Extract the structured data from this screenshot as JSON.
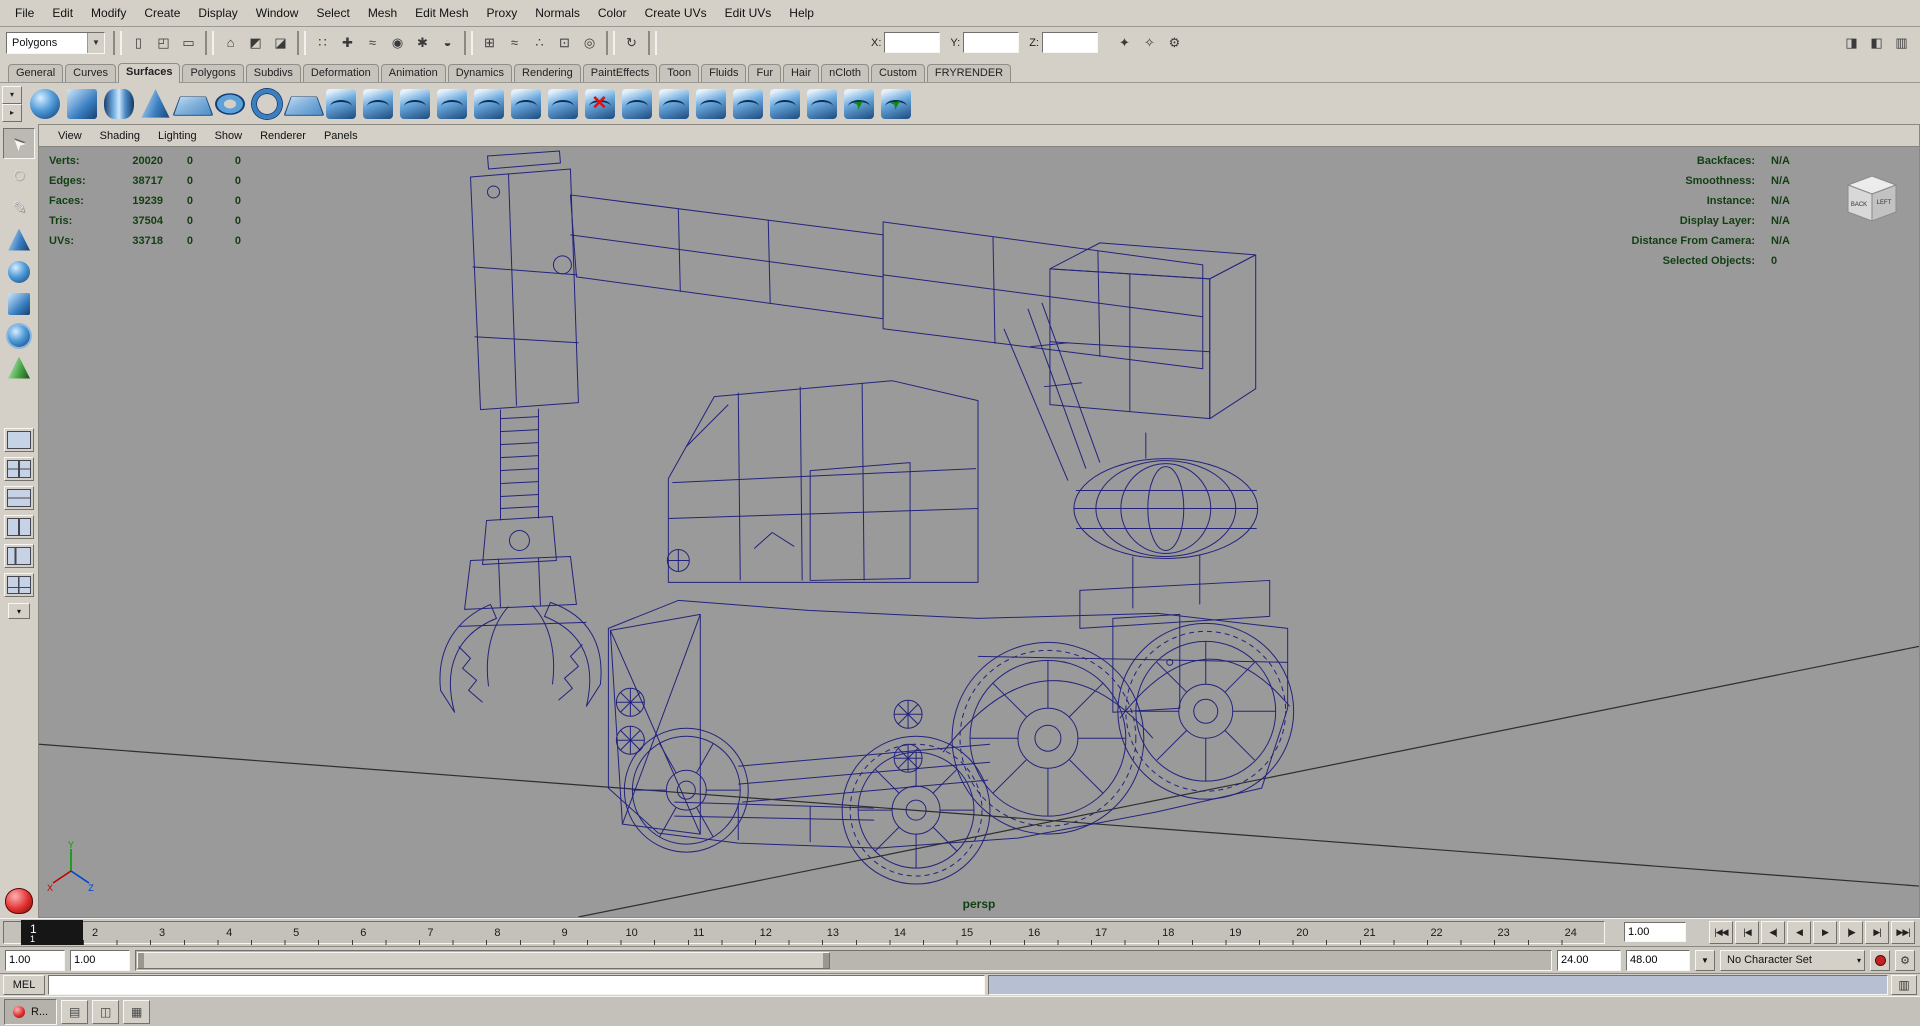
{
  "menubar": {
    "items": [
      "File",
      "Edit",
      "Modify",
      "Create",
      "Display",
      "Window",
      "Select",
      "Mesh",
      "Edit Mesh",
      "Proxy",
      "Normals",
      "Color",
      "Create UVs",
      "Edit UVs",
      "Help"
    ]
  },
  "status_line": {
    "selection_mode": "Polygons",
    "icons": [
      {
        "sep": true
      },
      {
        "name": "new-scene-icon",
        "glyph": "▯"
      },
      {
        "name": "open-scene-icon",
        "glyph": "◰"
      },
      {
        "name": "save-scene-icon",
        "glyph": "▭"
      },
      {
        "sep": true
      },
      {
        "name": "select-by-hierarchy-icon",
        "glyph": "⌂"
      },
      {
        "name": "select-by-object-icon",
        "glyph": "◩"
      },
      {
        "name": "select-by-component-icon",
        "glyph": "◪"
      },
      {
        "sep": true
      },
      {
        "name": "mask-points-icon",
        "glyph": "∷"
      },
      {
        "name": "mask-handles-icon",
        "glyph": "✚"
      },
      {
        "name": "mask-lines-icon",
        "glyph": "≈"
      },
      {
        "name": "mask-surfaces-icon",
        "glyph": "◉"
      },
      {
        "name": "mask-dynamics-icon",
        "glyph": "✱"
      },
      {
        "name": "mask-rendering-icon",
        "glyph": "◒"
      },
      {
        "sep": true
      },
      {
        "name": "snap-to-grid-icon",
        "glyph": "⊞"
      },
      {
        "name": "snap-to-curve-icon",
        "glyph": "≈"
      },
      {
        "name": "snap-to-point-icon",
        "glyph": "∴"
      },
      {
        "name": "snap-to-plane-icon",
        "glyph": "⊡"
      },
      {
        "name": "make-live-icon",
        "glyph": "◎"
      },
      {
        "sep": true
      },
      {
        "name": "construction-history-icon",
        "glyph": "↻"
      },
      {
        "sep": true
      }
    ],
    "coord_fields": {
      "x_label": "X:",
      "x_value": "",
      "y_label": "Y:",
      "y_value": "",
      "z_label": "Z:",
      "z_value": ""
    },
    "render_icons": [
      {
        "name": "render-current-frame-icon",
        "glyph": "✦"
      },
      {
        "name": "ipr-render-icon",
        "glyph": "✧"
      },
      {
        "name": "render-settings-icon",
        "glyph": "⚙"
      }
    ],
    "right_icons": [
      {
        "name": "attribute-editor-toggle-icon",
        "glyph": "◨"
      },
      {
        "name": "tool-settings-toggle-icon",
        "glyph": "◧"
      },
      {
        "name": "channel-box-toggle-icon",
        "glyph": "▥"
      }
    ]
  },
  "shelf": {
    "tabs": [
      "General",
      "Curves",
      "Surfaces",
      "Polygons",
      "Subdivs",
      "Deformation",
      "Animation",
      "Dynamics",
      "Rendering",
      "PaintEffects",
      "Toon",
      "Fluids",
      "Fur",
      "Hair",
      "nCloth",
      "Custom",
      "FRYRENDER"
    ],
    "active_tab": "Surfaces",
    "items": [
      {
        "name": "nurbs-sphere",
        "shape": "sphere"
      },
      {
        "name": "nurbs-cube",
        "shape": "cube"
      },
      {
        "name": "nurbs-cylinder",
        "shape": "cylinder"
      },
      {
        "name": "nurbs-cone",
        "shape": "cone"
      },
      {
        "name": "nurbs-plane",
        "shape": "plane"
      },
      {
        "name": "nurbs-torus",
        "shape": "torus"
      },
      {
        "name": "nurbs-circle",
        "shape": "ring"
      },
      {
        "name": "nurbs-square",
        "shape": "plane"
      },
      {
        "name": "revolve",
        "shape": "surf"
      },
      {
        "name": "loft",
        "shape": "surf"
      },
      {
        "name": "planar",
        "shape": "surf"
      },
      {
        "name": "extrude",
        "shape": "surf"
      },
      {
        "name": "birail",
        "shape": "surf"
      },
      {
        "name": "boundary",
        "shape": "surf"
      },
      {
        "name": "bevel",
        "shape": "surf"
      },
      {
        "name": "boolean-difference",
        "shape": "surf-red"
      },
      {
        "name": "trim-tool",
        "shape": "surf"
      },
      {
        "name": "untrim",
        "shape": "surf"
      },
      {
        "name": "attach-surfaces",
        "shape": "surf"
      },
      {
        "name": "detach-surfaces",
        "shape": "surf"
      },
      {
        "name": "align-surfaces",
        "shape": "surf"
      },
      {
        "name": "open-close-surface",
        "shape": "surf"
      },
      {
        "name": "insert-isoparms",
        "shape": "surf-green"
      },
      {
        "name": "project-curve",
        "shape": "surf-green"
      }
    ]
  },
  "toolbox": {
    "tools": [
      {
        "name": "select-tool",
        "shape": "arrow",
        "active": true
      },
      {
        "name": "lasso-tool",
        "shape": "lasso"
      },
      {
        "name": "paint-select-tool",
        "shape": "brush"
      },
      {
        "name": "move-tool",
        "shape": "cone"
      },
      {
        "name": "rotate-tool",
        "shape": "sphere"
      },
      {
        "name": "scale-tool",
        "shape": "cube"
      },
      {
        "name": "universal-manipulator-tool",
        "shape": "sphere-ring"
      },
      {
        "name": "soft-modification-tool",
        "shape": "cone-green"
      }
    ],
    "layouts": [
      {
        "name": "layout-single-pane",
        "style": "l1"
      },
      {
        "name": "layout-four-panes",
        "style": "l4"
      },
      {
        "name": "layout-two-panes-stacked",
        "style": "l3"
      },
      {
        "name": "layout-two-panes-side",
        "style": "l2"
      },
      {
        "name": "layout-persp-outliner",
        "style": "l5"
      },
      {
        "name": "layout-persp-graph",
        "style": "l6"
      }
    ],
    "layout_menu_glyph": "▾",
    "shelf_mini_glyphs": [
      "▾",
      "▸"
    ]
  },
  "panel_menu": {
    "items": [
      "View",
      "Shading",
      "Lighting",
      "Show",
      "Renderer",
      "Panels"
    ]
  },
  "hud": {
    "left": [
      {
        "label": "Verts:",
        "v1": "20020",
        "v2": "0",
        "v3": "0"
      },
      {
        "label": "Edges:",
        "v1": "38717",
        "v2": "0",
        "v3": "0"
      },
      {
        "label": "Faces:",
        "v1": "19239",
        "v2": "0",
        "v3": "0"
      },
      {
        "label": "Tris:",
        "v1": "37504",
        "v2": "0",
        "v3": "0"
      },
      {
        "label": "UVs:",
        "v1": "33718",
        "v2": "0",
        "v3": "0"
      }
    ],
    "right": [
      {
        "label": "Backfaces:",
        "value": "N/A"
      },
      {
        "label": "Smoothness:",
        "value": "N/A"
      },
      {
        "label": "Instance:",
        "value": "N/A"
      },
      {
        "label": "Display Layer:",
        "value": "N/A"
      },
      {
        "label": "Distance From Camera:",
        "value": "N/A"
      },
      {
        "label": "Selected Objects:",
        "value": "0"
      }
    ]
  },
  "viewport": {
    "camera_label": "persp",
    "axis": {
      "x": "X",
      "y": "Y",
      "z": "Z"
    },
    "viewcube": {
      "face1": "BACK",
      "face2": "LEFT"
    }
  },
  "timeline": {
    "current_frame": "1",
    "frame_numbers": [
      "2",
      "3",
      "4",
      "5",
      "6",
      "7",
      "8",
      "9",
      "10",
      "11",
      "12",
      "13",
      "14",
      "15",
      "16",
      "17",
      "18",
      "19",
      "20",
      "21",
      "22",
      "23",
      "24"
    ],
    "current_time": "1.00",
    "playback_buttons": [
      {
        "name": "go-to-start-button",
        "glyph": "|◀◀"
      },
      {
        "name": "step-back-frame-button",
        "glyph": "|◀"
      },
      {
        "name": "step-back-key-button",
        "glyph": "◀|"
      },
      {
        "name": "play-backwards-button",
        "glyph": "◀"
      },
      {
        "name": "play-forwards-button",
        "glyph": "▶"
      },
      {
        "name": "step-forward-key-button",
        "glyph": "|▶"
      },
      {
        "name": "step-forward-frame-button",
        "glyph": "▶|"
      },
      {
        "name": "go-to-end-button",
        "glyph": "▶▶|"
      }
    ]
  },
  "range_slider": {
    "anim_start": "1.00",
    "playback_start": "1.00",
    "playback_end": "24.00",
    "anim_end": "48.00",
    "character_set": "No Character Set",
    "dropdown_glyph": "▼"
  },
  "command_line": {
    "label": "MEL",
    "input_value": "",
    "result_value": ""
  },
  "taskbar": {
    "items": [
      {
        "name": "taskbar-app-button",
        "label": "R...",
        "icon": "maya-red"
      },
      {
        "name": "taskbar-window-button-1",
        "glyph": "▤"
      },
      {
        "name": "taskbar-window-button-2",
        "glyph": "◫"
      },
      {
        "name": "taskbar-window-button-3",
        "glyph": "▦"
      }
    ]
  },
  "colors": {
    "viewport_bg": "#9a9a9a",
    "wireframe": "#23237d",
    "hud_text": "#123f12",
    "ui_bg": "#d4d0c8",
    "result_field": "#b7c0d2"
  }
}
